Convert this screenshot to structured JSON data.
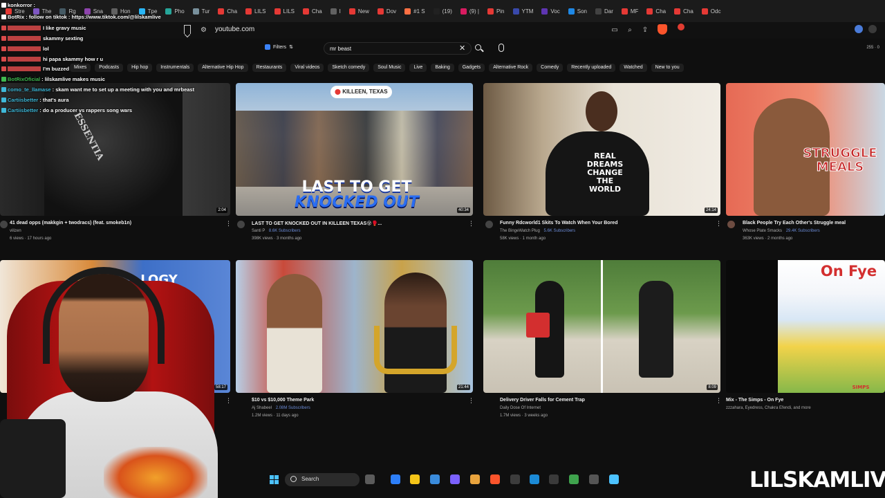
{
  "browser": {
    "tabs": [
      {
        "label": "Stre",
        "color": "#e53935"
      },
      {
        "label": "The",
        "color": "#7e57c2"
      },
      {
        "label": "Rg",
        "color": "#455a64"
      },
      {
        "label": "Sna",
        "color": "#8e44ad"
      },
      {
        "label": "Hon",
        "color": "#616161"
      },
      {
        "label": "Tpe",
        "color": "#29b6f6"
      },
      {
        "label": "Pho",
        "color": "#26a69a"
      },
      {
        "label": "Tur",
        "color": "#78909c"
      },
      {
        "label": "Cha",
        "color": "#e53935"
      },
      {
        "label": "LILS",
        "color": "#e53935"
      },
      {
        "label": "LILS",
        "color": "#e53935"
      },
      {
        "label": "Cha",
        "color": "#e53935"
      },
      {
        "label": "I",
        "color": "#616161"
      },
      {
        "label": "New",
        "color": "#e53935"
      },
      {
        "label": "Dov",
        "color": "#e53935"
      },
      {
        "label": "#1 S",
        "color": "#ff7043"
      },
      {
        "label": "(19)",
        "color": "#212121"
      },
      {
        "label": "(9) |",
        "color": "#d81b60"
      },
      {
        "label": "Pin",
        "color": "#e53935"
      },
      {
        "label": "YTM",
        "color": "#3949ab"
      },
      {
        "label": "Voc",
        "color": "#5e35b1"
      },
      {
        "label": "Son",
        "color": "#1e88e5"
      },
      {
        "label": "Dar",
        "color": "#424242"
      },
      {
        "label": "MF",
        "color": "#e53935"
      },
      {
        "label": "Cha",
        "color": "#e53935"
      },
      {
        "label": "Cha",
        "color": "#e53935"
      },
      {
        "label": "Odc",
        "color": "#e53935"
      }
    ],
    "url": "youtube.com"
  },
  "search": {
    "filters_label": "Filters",
    "query": "mr beast",
    "counter": "255 · 0"
  },
  "chips": [
    "Mixes",
    "Podcasts",
    "Hip hop",
    "Instrumentals",
    "Alternative Hip Hop",
    "Restaurants",
    "Viral videos",
    "Sketch comedy",
    "Soul Music",
    "Live",
    "Baking",
    "Gadgets",
    "Alternative Rock",
    "Comedy",
    "Recently uploaded",
    "Watched",
    "New to you"
  ],
  "chat": [
    {
      "user": "konkorror",
      "text": "",
      "color": "#ffffff"
    },
    {
      "user": "BotRix",
      "text": "follow on tiktok : https://www.tiktok.com/@lilskamlive",
      "color": "#ffffff"
    },
    {
      "user": "",
      "text": "I like gravy music",
      "color": "#d94a4a"
    },
    {
      "user": "",
      "text": "skammy sexting",
      "color": "#d94a4a"
    },
    {
      "user": "",
      "text": "lol",
      "color": "#d94a4a"
    },
    {
      "user": "",
      "text": "hi papa skammy how r u",
      "color": "#d94a4a"
    },
    {
      "user": "",
      "text": "I'm buzzed",
      "color": "#d94a4a"
    },
    {
      "user": "",
      "text": "lilskamlive makes music",
      "color": "#d94a4a"
    },
    {
      "user": "BotRixOficial",
      "text": "lilskamlive makes music",
      "color": "#3fb950"
    },
    {
      "user": "como_te_llamase",
      "text": "skam want me to set up a meeting with you and mrbeast",
      "color": "#3fb9d9"
    },
    {
      "user": "Cartiisbetter",
      "text": "that's aura",
      "color": "#3fb9d9"
    },
    {
      "user": "Cartiisbetter",
      "text": "do a producer vs rappers song wars",
      "color": "#3fb9d9"
    }
  ],
  "videos": [
    {
      "title": "41 dead opps (makkgin + twodracs) (feat. smokeb1n)",
      "channel": "vilizen",
      "subs": "",
      "meta": "6 views · 17 hours ago",
      "duration": "2:04"
    },
    {
      "title": "LAST TO GET KNOCKED OUT IN KILLEEN TEXAS😵🥊...",
      "channel": "Santi P",
      "subs": "8.6K Subscribers",
      "meta": "398K views · 3 months ago",
      "duration": "40:34",
      "overlay_top": "LAST TO GET",
      "overlay_bottom": "KNOCKED OUT",
      "location": "KILLEEN, TEXAS"
    },
    {
      "title": "Funny Rdcworld1 Skits To Watch When Your Bored",
      "channel": "The BingeWatch Plug",
      "subs": "5.6K Subscribers",
      "meta": "58K views · 1 month ago",
      "duration": "24:14",
      "hoodie": "REAL DREAMS CHANGE THE WORLD"
    },
    {
      "title": "Black People Try Each Other's Struggle meal",
      "channel": "Whose Plate Smacks",
      "subs": "29.4K Subscribers",
      "meta": "363K views · 2 months ago",
      "duration": "",
      "overlay": "STRUGGLE MEALS"
    },
    {
      "title": "",
      "channel": "",
      "subs": "",
      "meta": "",
      "duration": "58:17",
      "overlay": "LOGY"
    },
    {
      "title": "$10 vs $10,000 Theme Park",
      "channel": "Aj Shabeel",
      "subs": "2.08M Subscribers",
      "meta": "1.2M views · 11 days ago",
      "duration": "21:44"
    },
    {
      "title": "Delivery Driver Falls for Cement Trap",
      "channel": "Daily Dose Of Internet",
      "subs": "",
      "meta": "1.7M views · 3 weeks ago",
      "duration": "8:09"
    },
    {
      "title": "Mix - The Simps - On Fye",
      "channel": "zzzahara, Eyedress, Chakra Efendi, and more",
      "subs": "",
      "meta": "",
      "duration": "",
      "overlay": "On Fye",
      "overlay_small": "SIMPS"
    }
  ],
  "taskbar": {
    "search_label": "Search"
  },
  "streamer": "LILSKAMLIVE",
  "colors": {
    "page_bg": "#0f0f0f",
    "chat_user": "#d94a4a",
    "subs_link": "#6b8bd6"
  }
}
